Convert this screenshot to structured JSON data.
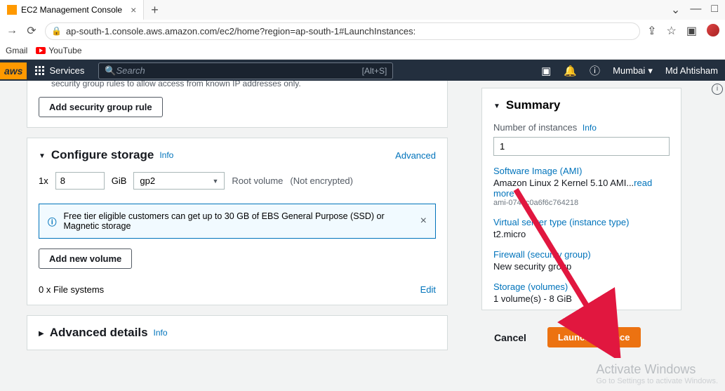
{
  "browser": {
    "tab_title": "EC2 Management Console",
    "url": "ap-south-1.console.aws.amazon.com/ec2/home?region=ap-south-1#LaunchInstances:",
    "bookmarks": {
      "gmail": "Gmail",
      "youtube": "YouTube"
    }
  },
  "nav": {
    "services": "Services",
    "search_placeholder": "Search",
    "search_shortcut": "[Alt+S]",
    "region": "Mumbai",
    "user": "Md Ahtisham"
  },
  "security_group": {
    "warning_tail": "security group rules to allow access from known IP addresses only.",
    "add_rule_btn": "Add security group rule"
  },
  "configure_storage": {
    "title": "Configure storage",
    "info": "Info",
    "advanced": "Advanced",
    "qty_prefix": "1x",
    "size_value": "8",
    "size_unit": "GiB",
    "vol_type": "gp2",
    "root_label": "Root volume",
    "enc_label": "(Not encrypted)",
    "free_tier_msg": "Free tier eligible customers can get up to 30 GB of EBS General Purpose (SSD) or Magnetic storage",
    "add_volume_btn": "Add new volume",
    "fs_label": "0 x File systems",
    "edit": "Edit"
  },
  "advanced_details": {
    "title": "Advanced details",
    "info": "Info"
  },
  "summary": {
    "title": "Summary",
    "num_instances_label": "Number of instances",
    "num_instances_info": "Info",
    "num_instances_value": "1",
    "ami_link": "Software Image (AMI)",
    "ami_name": "Amazon Linux 2 Kernel 5.10 AMI...",
    "ami_read_more": "read more",
    "ami_id": "ami-074dc0a6f6c764218",
    "instance_type_link": "Virtual server type (instance type)",
    "instance_type_val": "t2.micro",
    "firewall_link": "Firewall (security group)",
    "firewall_val": "New security group",
    "storage_link": "Storage (volumes)",
    "storage_val": "1 volume(s) - 8 GiB",
    "cancel": "Cancel",
    "launch": "Launch instance"
  },
  "watermark": {
    "line1": "Activate Windows",
    "line2": "Go to Settings to activate Windows."
  }
}
